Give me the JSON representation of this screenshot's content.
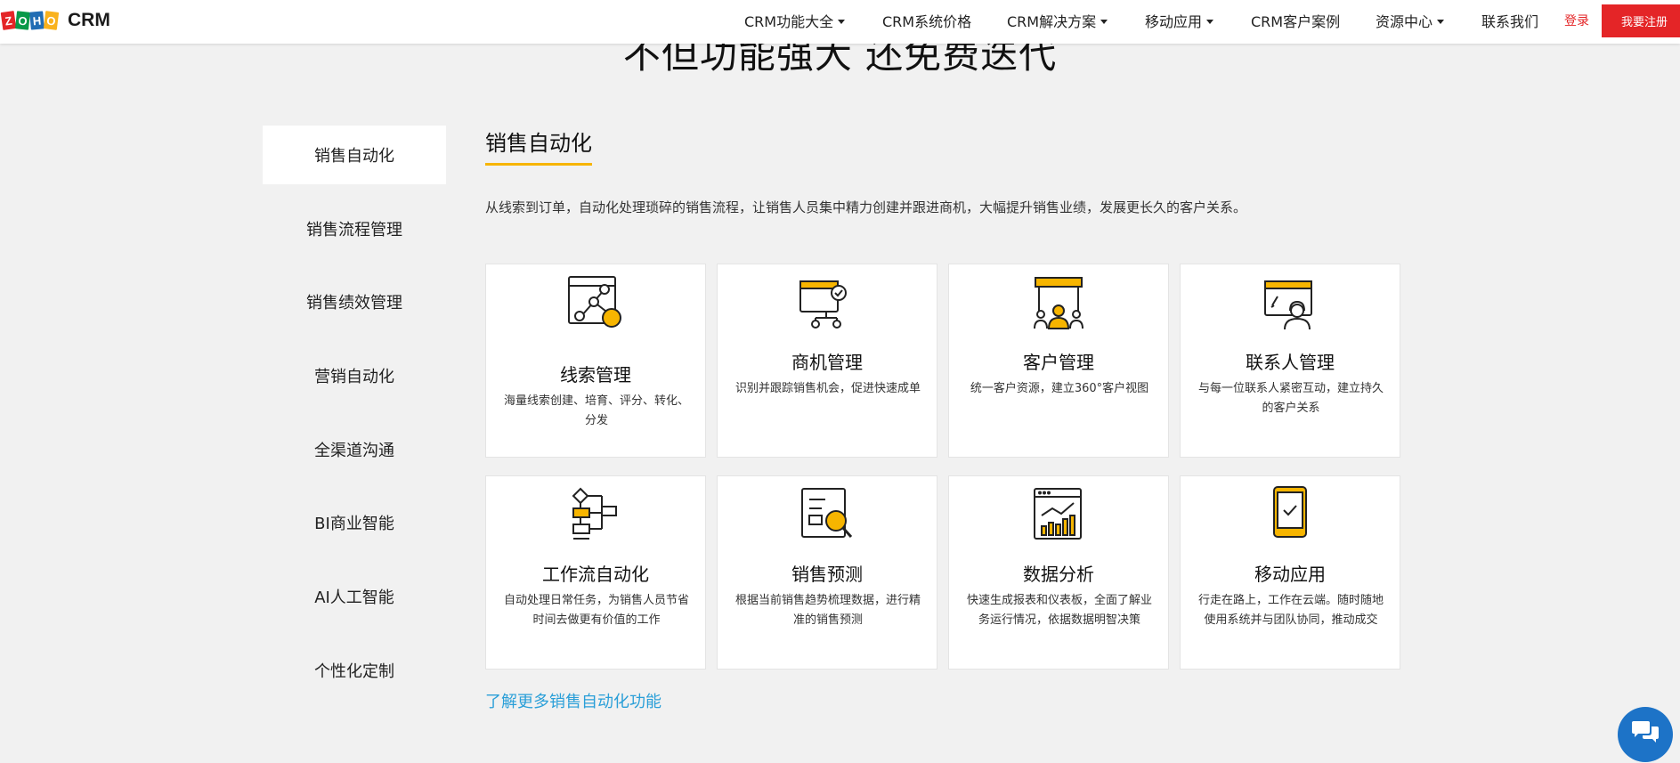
{
  "brand": {
    "logo_letters": [
      "Z",
      "O",
      "H",
      "O"
    ],
    "logo_colors": [
      "#e42527",
      "#089949",
      "#226db4",
      "#f9b21d"
    ],
    "product": "CRM"
  },
  "nav": {
    "items": [
      {
        "label": "CRM功能大全",
        "dropdown": true
      },
      {
        "label": "CRM系统价格",
        "dropdown": false
      },
      {
        "label": "CRM解决方案",
        "dropdown": true
      },
      {
        "label": "移动应用",
        "dropdown": true
      },
      {
        "label": "CRM客户案例",
        "dropdown": false
      },
      {
        "label": "资源中心",
        "dropdown": true
      },
      {
        "label": "联系我们",
        "dropdown": false
      }
    ],
    "login": "登录",
    "register": "我要注册"
  },
  "hero": {
    "title": "不但功能强大 还免费迭代"
  },
  "sidebar": {
    "items": [
      {
        "label": "销售自动化",
        "active": true
      },
      {
        "label": "销售流程管理"
      },
      {
        "label": "销售绩效管理"
      },
      {
        "label": "营销自动化"
      },
      {
        "label": "全渠道沟通"
      },
      {
        "label": "BI商业智能"
      },
      {
        "label": "AI人工智能"
      },
      {
        "label": "个性化定制"
      }
    ]
  },
  "section": {
    "title": "销售自动化",
    "description": "从线索到订单，自动化处理琐碎的销售流程，让销售人员集中精力创建并跟进商机，大幅提升销售业绩，发展更长久的客户关系。",
    "more_link": "了解更多销售自动化功能"
  },
  "cards": [
    {
      "title": "线索管理",
      "desc": "海量线索创建、培育、评分、转化、分发",
      "icon": "lead-icon"
    },
    {
      "title": "商机管理",
      "desc": "识别并跟踪销售机会，促进快速成单",
      "icon": "deal-icon"
    },
    {
      "title": "客户管理",
      "desc": "统一客户资源，建立360°客户视图",
      "icon": "customer-icon"
    },
    {
      "title": "联系人管理",
      "desc": "与每一位联系人紧密互动，建立持久的客户关系",
      "icon": "contact-icon"
    },
    {
      "title": "工作流自动化",
      "desc": "自动处理日常任务，为销售人员节省时间去做更有价值的工作",
      "icon": "workflow-icon"
    },
    {
      "title": "销售预测",
      "desc": "根据当前销售趋势梳理数据，进行精准的销售预测",
      "icon": "forecast-icon"
    },
    {
      "title": "数据分析",
      "desc": "快速生成报表和仪表板，全面了解业务运行情况，依据数据明智决策",
      "icon": "analytics-icon"
    },
    {
      "title": "移动应用",
      "desc": "行走在路上，工作在云端。随时随地使用系统并与团队协同，推动成交",
      "icon": "mobile-icon"
    }
  ],
  "colors": {
    "accent_yellow": "#f7b500",
    "register_red": "#e42527",
    "link_blue": "#2a9fd8",
    "chat_blue": "#1d73c7"
  }
}
